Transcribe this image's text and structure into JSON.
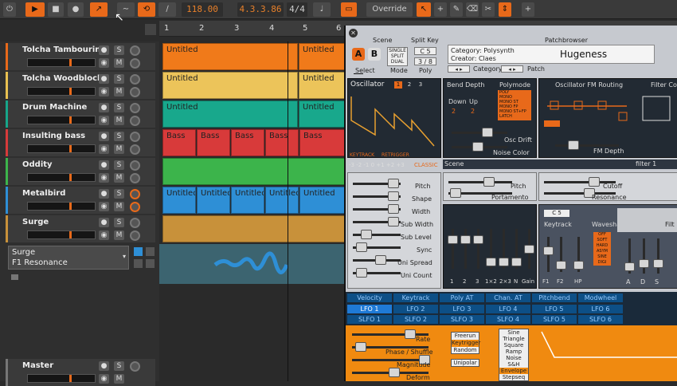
{
  "toolbar": {
    "tempo": "118.00",
    "position": "4.3.3.86",
    "signature": "4/4",
    "override": "Override"
  },
  "ruler": [
    "1",
    "2",
    "3",
    "4",
    "5",
    "6"
  ],
  "tracks": [
    {
      "name": "Tolcha Tambourin...",
      "color": "#e8691a"
    },
    {
      "name": "Tolcha Woodblocks",
      "color": "#e8c050"
    },
    {
      "name": "Drum Machine",
      "color": "#17a589"
    },
    {
      "name": "Insulting bass",
      "color": "#d63a3a"
    },
    {
      "name": "Oddity",
      "color": "#3cb44b"
    },
    {
      "name": "Metalbird",
      "color": "#2e8fd6"
    },
    {
      "name": "Surge",
      "color": "#c8913a"
    }
  ],
  "surge_device": {
    "name": "Surge",
    "param": "F1 Resonance"
  },
  "master": "Master",
  "clips": {
    "untitled": "Untitled",
    "bass": "Bass"
  },
  "plugin": {
    "scene_label": "Scene",
    "scene_a": "A",
    "scene_b": "B",
    "split_key_label": "Split Key",
    "split_key_value": "C 5",
    "poly_value": "3 / 8",
    "mode_single": "SINGLE",
    "mode_split": "SPLIT",
    "mode_dual": "DUAL",
    "select_label": "Select",
    "mode_label": "Mode",
    "poly_label": "Poly",
    "patchbrowser_label": "Patchbrowser",
    "category": "Category: Polysynth",
    "creator": "Creator: Claes",
    "patch_name": "Hugeness",
    "category_btn": "Category",
    "patch_btn": "Patch",
    "oscillator": "Oscillator",
    "osc_nums": [
      "1",
      "2",
      "3"
    ],
    "bend_depth": "Bend Depth",
    "down": "Down",
    "up": "Up",
    "bend_vals": [
      "2",
      "2"
    ],
    "polymode": "Polymode",
    "polymode_items": [
      "POLY",
      "MONO",
      "MONO ST",
      "MONO FP",
      "MONO ST+FP",
      "LATCH"
    ],
    "osc_drift": "Osc Drift",
    "noise_color": "Noise Color",
    "osc_fm_routing": "Oscillator FM Routing",
    "fm_depth": "FM Depth",
    "filter_conf": "Filter Co",
    "keytrack": "KEYTRACK",
    "retrigger": "RETRIGGER",
    "classic": "CLASSIC",
    "scene2": "Scene",
    "filter1": "filter 1",
    "osc_sliders": [
      "Pitch",
      "Shape",
      "Width",
      "Sub Width",
      "Sub Level",
      "Sync",
      "Uni Spread",
      "Uni Count"
    ],
    "pitch2": "Pitch",
    "portamento": "Portamento",
    "cutoff": "Cutoff",
    "resonance": "Resonance",
    "keytrack2": "Keytrack",
    "keytrack_val": "C 5",
    "waveshaper": "Waveshaper",
    "waveshaper_items": [
      "OFF",
      "SOFT",
      "HARD",
      "ASYM",
      "SINE",
      "DIGI"
    ],
    "filt": "Filt",
    "mixer_labels": [
      "1",
      "2",
      "3",
      "1×2",
      "2×3",
      "N",
      "Gain"
    ],
    "fb_labels": [
      "F1",
      "F2",
      "HP"
    ],
    "adsr": [
      "A",
      "D",
      "S"
    ],
    "mod_headers": [
      "Velocity",
      "Keytrack",
      "Poly AT",
      "Chan. AT",
      "Pitchbend",
      "Modwheel"
    ],
    "lfo_row1": [
      "LFO 1",
      "LFO 2",
      "LFO 3",
      "LFO 4",
      "LFO 5",
      "LFO 6"
    ],
    "lfo_row2": [
      "SLFO 1",
      "SLFO 2",
      "SLFO 3",
      "SLFO 4",
      "SLFO 5",
      "SLFO 6"
    ],
    "lfo_sliders": [
      "Rate",
      "Phase / Shuffle",
      "Magnitude",
      "Deform"
    ],
    "trig_items": [
      "Freerun",
      "Keytrigger",
      "Random"
    ],
    "unipolar": "Unipolar",
    "wave_items": [
      "Sine",
      "Triangle",
      "Square",
      "Ramp",
      "Noise",
      "S&H",
      "Envelope",
      "Stepseq"
    ]
  }
}
